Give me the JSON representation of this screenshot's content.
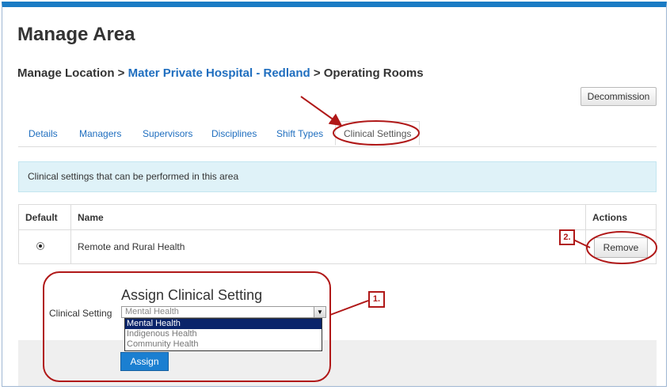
{
  "page": {
    "title": "Manage Area",
    "breadcrumb": {
      "part1": "Manage Location > ",
      "hospital": "Mater Private Hospital - Redland",
      "part2": " > Operating Rooms"
    },
    "decommission_label": "Decommission"
  },
  "tabs": [
    {
      "label": "Details"
    },
    {
      "label": "Managers"
    },
    {
      "label": "Supervisors"
    },
    {
      "label": "Disciplines"
    },
    {
      "label": "Shift Types"
    },
    {
      "label": "Clinical Settings",
      "active": true
    }
  ],
  "info_text": "Clinical settings that can be performed in this area",
  "table": {
    "headers": {
      "default": "Default",
      "name": "Name",
      "actions": "Actions"
    },
    "rows": [
      {
        "default": true,
        "name": "Remote and Rural Health",
        "action_label": "Remove"
      }
    ]
  },
  "assign": {
    "title": "Assign Clinical Setting",
    "field_label": "Clinical Setting",
    "selected_value": "Mental Health",
    "options": [
      "Mental Health",
      "Indigenous Health",
      "Community Health"
    ],
    "button_label": "Assign"
  },
  "annotations": {
    "callout1": "1.",
    "callout2": "2.",
    "color": "#b01818"
  }
}
